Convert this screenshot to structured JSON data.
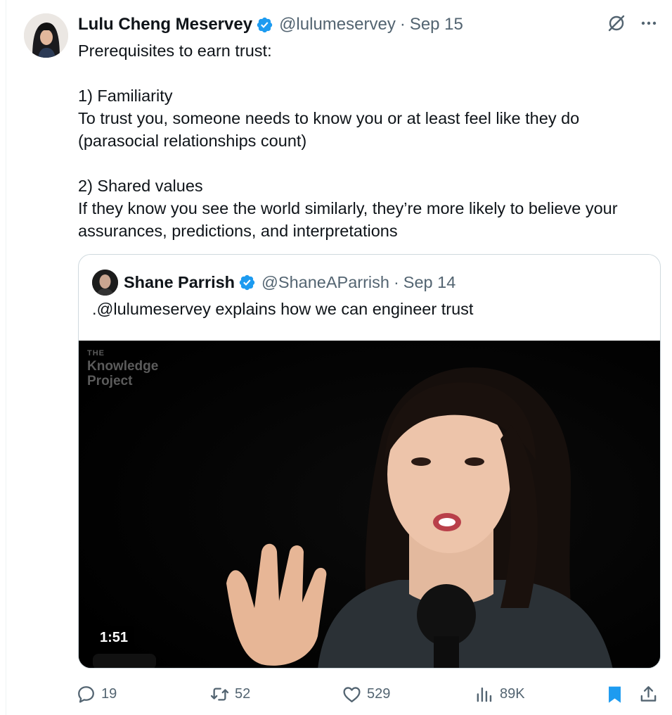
{
  "tweet": {
    "author_name": "Lulu Cheng Meservey",
    "handle": "@lulumeservey",
    "separator": "·",
    "date": "Sep 15",
    "text": "Prerequisites to earn trust:\n\n1) Familiarity\nTo trust you, someone needs to know you or at least feel like they do (parasocial relationships count)\n\n2) Shared values\nIf they know you see the world similarly, they’re more likely to believe your assurances, predictions, and interpretations"
  },
  "quote": {
    "author_name": "Shane Parrish",
    "handle": "@ShaneAParrish",
    "separator": "·",
    "date": "Sep 14",
    "text": ".@lulumeservey explains how we can engineer trust",
    "video": {
      "logo_the": "THE",
      "logo_line1": "Knowledge",
      "logo_line2": "Project",
      "duration": "1:51"
    }
  },
  "actions": {
    "replies": "19",
    "retweets": "52",
    "likes": "529",
    "views": "89K"
  },
  "icons": {
    "verified": "verified-badge-icon",
    "grok": "grok-icon",
    "more": "more-icon",
    "reply": "reply-icon",
    "retweet": "retweet-icon",
    "like": "heart-icon",
    "views": "views-icon",
    "bookmark": "bookmark-icon",
    "share": "share-icon"
  },
  "colors": {
    "verified": "#1d9bf0",
    "secondary_text": "#536471",
    "bookmark_active": "#1d9bf0",
    "border": "#cfd9de"
  }
}
